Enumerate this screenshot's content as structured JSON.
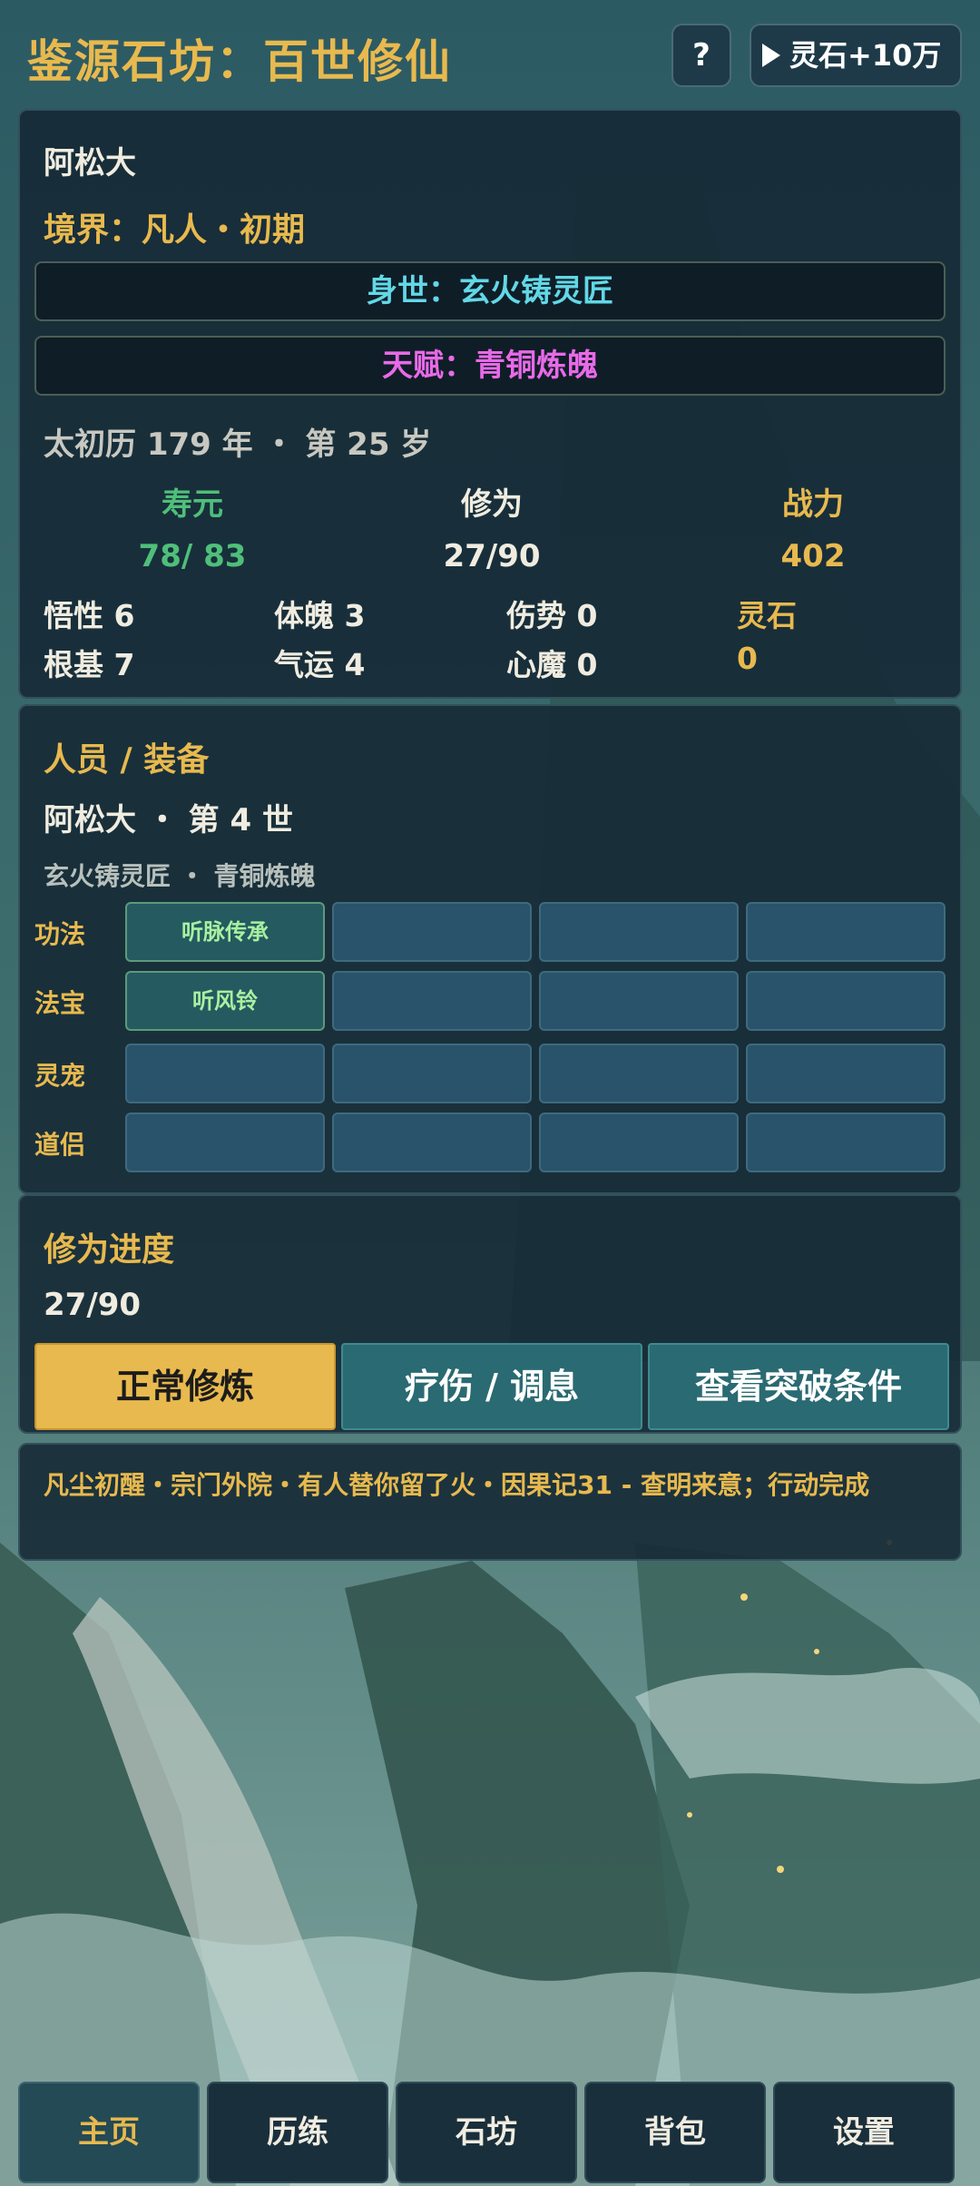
{
  "header": {
    "title": "鉴源石坊：百世修仙",
    "help_label": "?",
    "reward_label": "灵石+10万"
  },
  "character": {
    "name": "阿松大",
    "realm": "境界：凡人・初期",
    "origin": "身世：玄火铸灵匠",
    "talent": "天赋：青铜炼魄",
    "calendar": "太初历 179 年 ・ 第 25 岁",
    "stats": [
      {
        "label": "寿元",
        "value": "78/ 83",
        "color": "#4fbf7a"
      },
      {
        "label": "修为",
        "value": "27/90",
        "color": "#f0ece0"
      },
      {
        "label": "战力",
        "value": "402",
        "color": "#e8b94e"
      }
    ],
    "attributes": {
      "wuxing": "悟性 6",
      "tipo": "体魄 3",
      "shangshi": "伤势 0",
      "lingshi_label": "灵石",
      "genji": "根基 7",
      "qiyun": "气运 4",
      "xinmo": "心魔 0",
      "lingshi_value": "0"
    }
  },
  "equipment": {
    "title": "人员 / 装备",
    "incarnation": "阿松大 ・ 第 4 世",
    "sub_info": "玄火铸灵匠 ・ 青铜炼魄",
    "rows": [
      {
        "label": "功法",
        "slots": [
          "听脉传承",
          "",
          "",
          ""
        ]
      },
      {
        "label": "法宝",
        "slots": [
          "听风铃",
          "",
          "",
          ""
        ]
      },
      {
        "label": "灵宠",
        "slots": [
          "",
          "",
          "",
          ""
        ]
      },
      {
        "label": "道侣",
        "slots": [
          "",
          "",
          "",
          ""
        ]
      }
    ]
  },
  "progress": {
    "title": "修为进度",
    "value": "27/90",
    "buttons": [
      "正常修炼",
      "疗伤 / 调息",
      "查看突破条件"
    ]
  },
  "log": {
    "text": "凡尘初醒・宗门外院・有人替你留了火・因果记31 - 查明来意；行动完成"
  },
  "nav": {
    "tabs": [
      "主页",
      "历练",
      "石坊",
      "背包",
      "设置"
    ],
    "active": "主页"
  }
}
